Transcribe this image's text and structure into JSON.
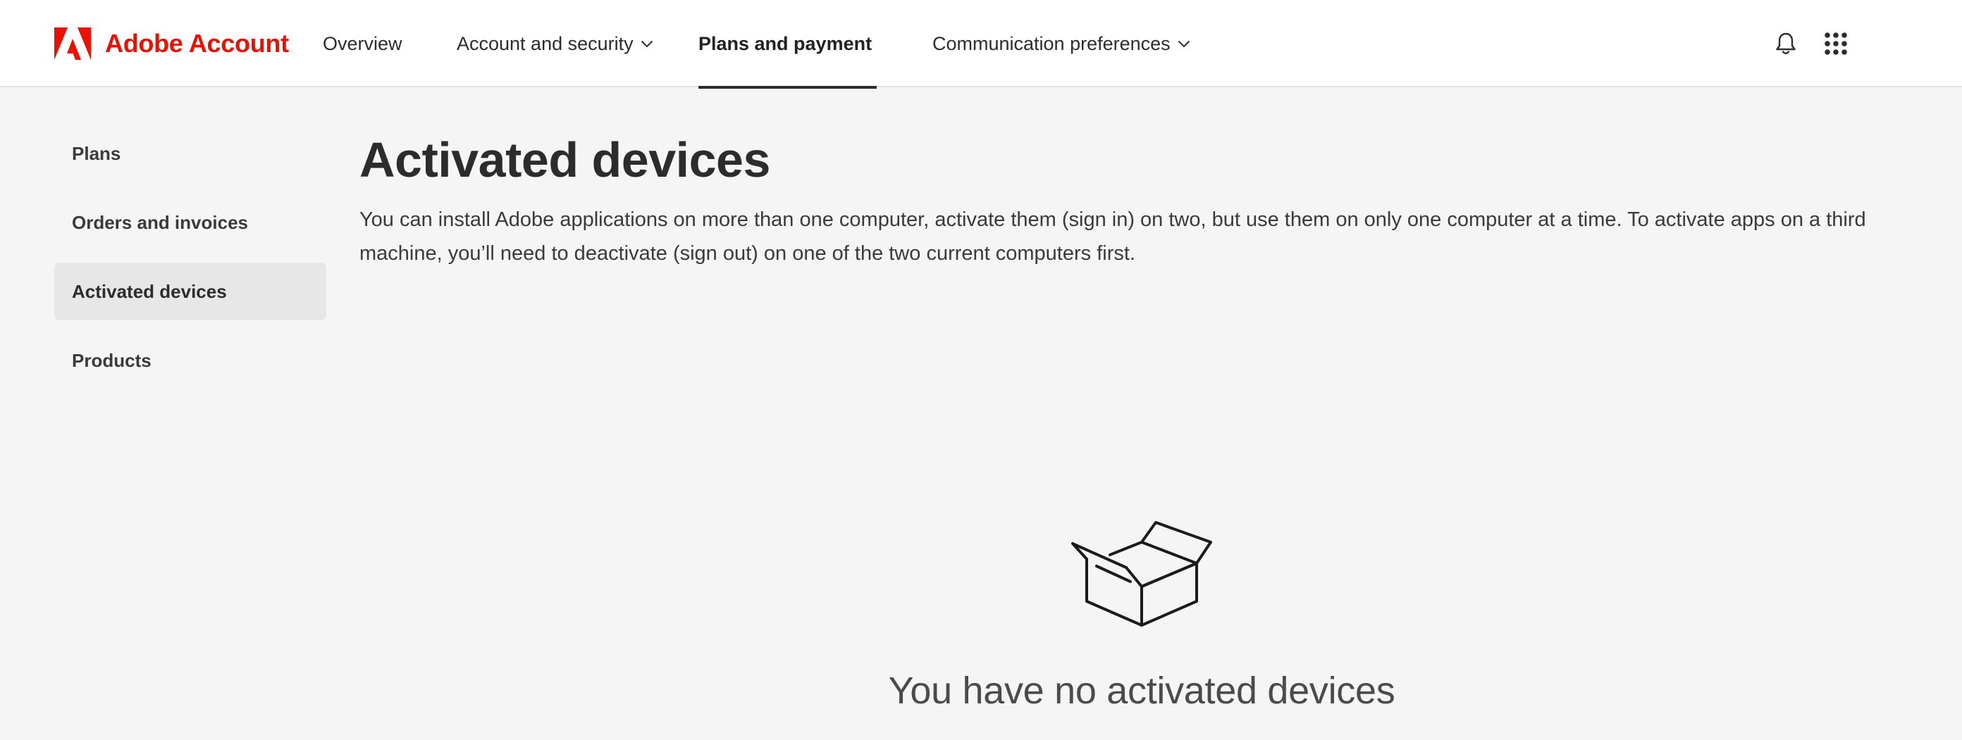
{
  "brand": {
    "name": "Adobe Account",
    "color": "#eb1000"
  },
  "topnav": {
    "items": [
      {
        "label": "Overview",
        "has_dropdown": false,
        "active": false
      },
      {
        "label": "Account and security",
        "has_dropdown": true,
        "active": false
      },
      {
        "label": "Plans and payment",
        "has_dropdown": true,
        "active": true
      },
      {
        "label": "Communication preferences",
        "has_dropdown": true,
        "active": false
      }
    ],
    "icons": [
      "bell-icon",
      "app-grid-icon"
    ]
  },
  "sidebar": {
    "items": [
      {
        "label": "Plans",
        "selected": false
      },
      {
        "label": "Orders and invoices",
        "selected": false
      },
      {
        "label": "Activated devices",
        "selected": true
      },
      {
        "label": "Products",
        "selected": false
      }
    ]
  },
  "main": {
    "title": "Activated devices",
    "description": "You can install Adobe applications on more than one computer, activate them (sign in) on two, but use them on only one computer at a time. To activate apps on a third machine, you’ll need to deactivate (sign out) on one of the two current computers first.",
    "empty_state": {
      "icon": "open-box-icon",
      "message": "You have no activated devices"
    }
  }
}
